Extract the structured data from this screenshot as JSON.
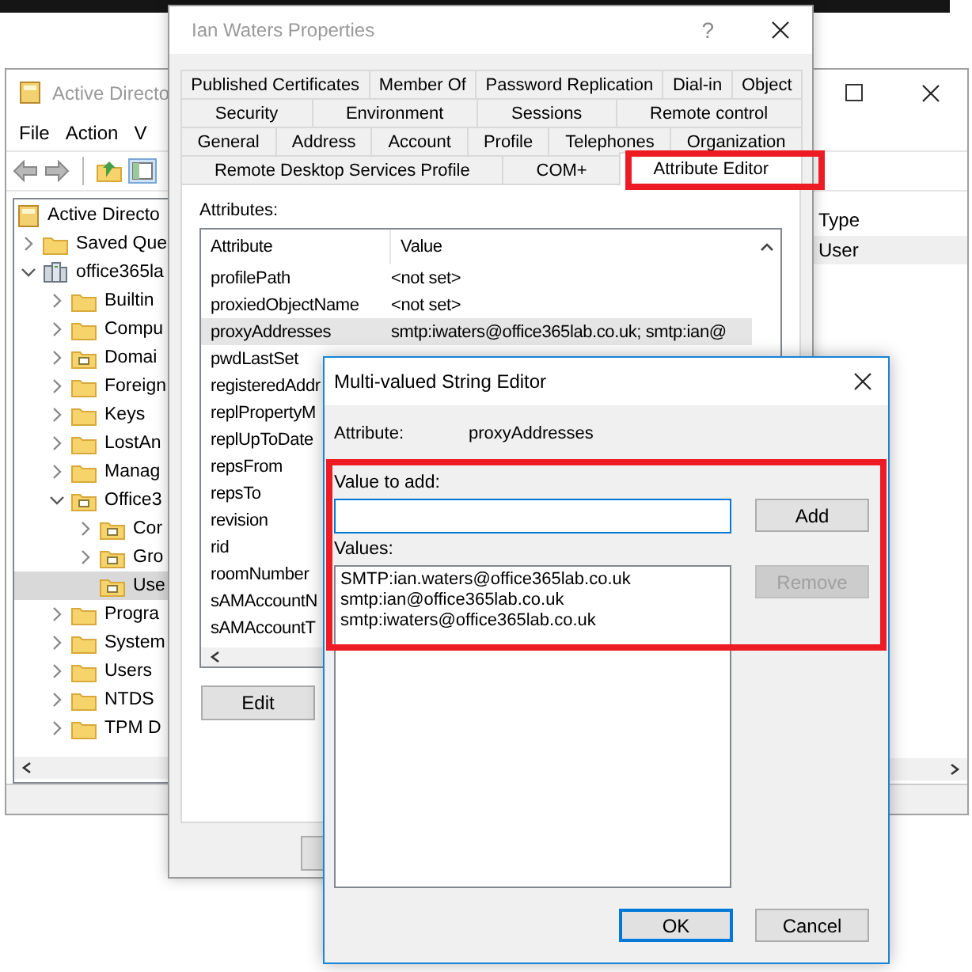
{
  "explorer": {
    "title": "Active Directo",
    "menu": [
      "File",
      "Action",
      "V"
    ],
    "tree": [
      {
        "label": "Active Directo",
        "kind": "console",
        "selected": false,
        "children": [
          {
            "label": "Saved Que",
            "kind": "folder",
            "expanded": false,
            "selected": false
          },
          {
            "label": "office365la",
            "kind": "domain",
            "expanded": true,
            "selected": false,
            "children": [
              {
                "label": "Builtin",
                "kind": "folder",
                "expanded": false,
                "selected": false
              },
              {
                "label": "Compu",
                "kind": "folder",
                "expanded": false,
                "selected": false
              },
              {
                "label": "Domai",
                "kind": "ou",
                "expanded": false,
                "selected": false
              },
              {
                "label": "Foreign",
                "kind": "folder",
                "expanded": false,
                "selected": false
              },
              {
                "label": "Keys",
                "kind": "folder",
                "expanded": false,
                "selected": false
              },
              {
                "label": "LostAn",
                "kind": "folder",
                "expanded": false,
                "selected": false
              },
              {
                "label": "Manag",
                "kind": "folder",
                "expanded": false,
                "selected": false
              },
              {
                "label": "Office3",
                "kind": "ou",
                "expanded": true,
                "selected": false,
                "children": [
                  {
                    "label": "Cor",
                    "kind": "ou",
                    "expanded": false,
                    "selected": false
                  },
                  {
                    "label": "Gro",
                    "kind": "ou",
                    "expanded": false,
                    "selected": false
                  },
                  {
                    "label": "Use",
                    "kind": "ou",
                    "selected": true
                  }
                ]
              },
              {
                "label": "Progra",
                "kind": "folder",
                "expanded": false,
                "selected": false
              },
              {
                "label": "System",
                "kind": "folder",
                "expanded": false,
                "selected": false
              },
              {
                "label": "Users",
                "kind": "folder",
                "expanded": false,
                "selected": false
              },
              {
                "label": "NTDS",
                "kind": "folder",
                "expanded": false,
                "selected": false
              },
              {
                "label": "TPM D",
                "kind": "folder",
                "expanded": false,
                "selected": false
              }
            ]
          }
        ]
      }
    ],
    "list": {
      "columns": [
        "Type"
      ],
      "rows": [
        {
          "cells": [
            "User"
          ],
          "selected": true
        }
      ]
    }
  },
  "properties": {
    "title": "Ian Waters Properties",
    "help": "?",
    "tab_rows": [
      [
        {
          "label": "Published Certificates",
          "selected": false
        },
        {
          "label": "Member Of",
          "selected": false
        },
        {
          "label": "Password Replication",
          "selected": false
        },
        {
          "label": "Dial-in",
          "selected": false
        },
        {
          "label": "Object",
          "selected": false
        }
      ],
      [
        {
          "label": "Security",
          "selected": false
        },
        {
          "label": "Environment",
          "selected": false
        },
        {
          "label": "Sessions",
          "selected": false
        },
        {
          "label": "Remote control",
          "selected": false
        }
      ],
      [
        {
          "label": "General",
          "selected": false
        },
        {
          "label": "Address",
          "selected": false
        },
        {
          "label": "Account",
          "selected": false
        },
        {
          "label": "Profile",
          "selected": false
        },
        {
          "label": "Telephones",
          "selected": false
        },
        {
          "label": "Organization",
          "selected": false
        }
      ],
      [
        {
          "label": "Remote Desktop Services Profile",
          "selected": false
        },
        {
          "label": "COM+",
          "selected": false
        },
        {
          "label": "Attribute Editor",
          "selected": true,
          "highlighted": true
        }
      ]
    ],
    "attributes_label": "Attributes:",
    "columns": [
      "Attribute",
      "Value"
    ],
    "rows": [
      {
        "name": "profilePath",
        "value": "<not set>",
        "selected": false
      },
      {
        "name": "proxiedObjectName",
        "value": "<not set>",
        "selected": false
      },
      {
        "name": "proxyAddresses",
        "value": "smtp:iwaters@office365lab.co.uk; smtp:ian@",
        "selected": true
      },
      {
        "name": "pwdLastSet",
        "selected": false
      },
      {
        "name": "registeredAddr",
        "selected": false
      },
      {
        "name": "replPropertyM",
        "selected": false
      },
      {
        "name": "replUpToDate",
        "selected": false
      },
      {
        "name": "repsFrom",
        "selected": false
      },
      {
        "name": "repsTo",
        "selected": false
      },
      {
        "name": "revision",
        "selected": false
      },
      {
        "name": "rid",
        "selected": false
      },
      {
        "name": "roomNumber",
        "selected": false
      },
      {
        "name": "sAMAccountN",
        "selected": false
      },
      {
        "name": "sAMAccountT",
        "selected": false
      }
    ],
    "edit_button": "Edit"
  },
  "dialog": {
    "title": "Multi-valued String Editor",
    "attribute_label": "Attribute:",
    "attribute_value": "proxyAddresses",
    "value_label": "Value to add:",
    "input": {
      "focused": true
    },
    "values_label": "Values:",
    "values": [
      "SMTP:ian.waters@office365lab.co.uk",
      "smtp:ian@office365lab.co.uk",
      "smtp:iwaters@office365lab.co.uk"
    ],
    "side_buttons": [
      {
        "label": "Add",
        "disabled": false
      },
      {
        "label": "Remove",
        "disabled": true
      }
    ],
    "footer_buttons": [
      {
        "label": "OK",
        "default": true
      },
      {
        "label": "Cancel",
        "default": false
      }
    ],
    "highlighted": true
  }
}
